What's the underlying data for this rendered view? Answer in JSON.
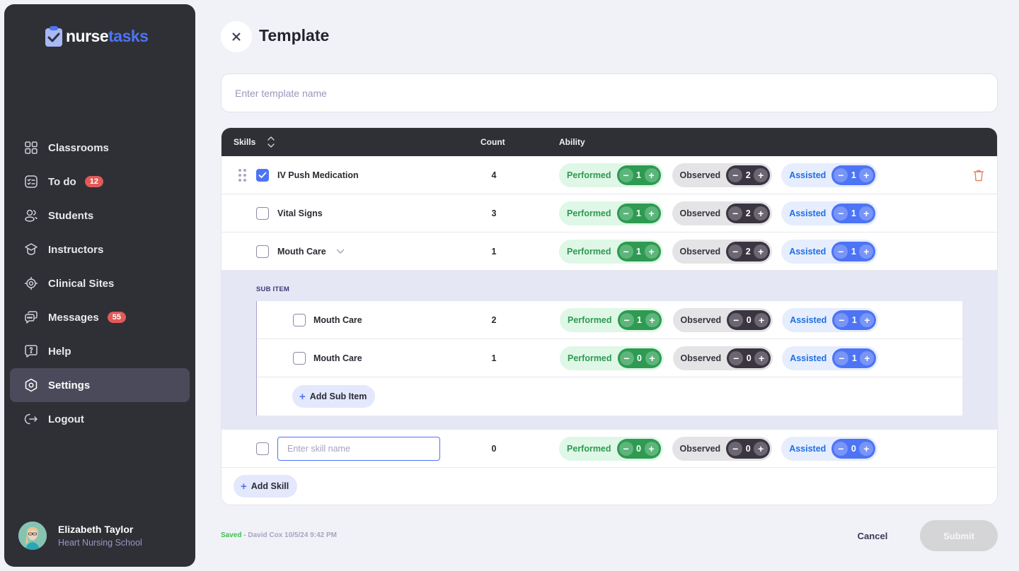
{
  "brand": {
    "name_part1": "nurse",
    "name_part2": "tasks",
    "accent": "#4d74f5"
  },
  "sidebar": {
    "items": [
      {
        "label": "Classrooms",
        "icon": "grid-icon",
        "badge": null
      },
      {
        "label": "To do",
        "icon": "checklist-icon",
        "badge": "12"
      },
      {
        "label": "Students",
        "icon": "users-icon",
        "badge": null
      },
      {
        "label": "Instructors",
        "icon": "graduation-cap-icon",
        "badge": null
      },
      {
        "label": "Clinical Sites",
        "icon": "target-icon",
        "badge": null
      },
      {
        "label": "Messages",
        "icon": "chat-icon",
        "badge": "55"
      },
      {
        "label": "Help",
        "icon": "help-icon",
        "badge": null
      },
      {
        "label": "Settings",
        "icon": "settings-icon",
        "badge": null,
        "active": true
      },
      {
        "label": "Logout",
        "icon": "logout-icon",
        "badge": null
      }
    ],
    "user": {
      "name": "Elizabeth Taylor",
      "school": "Heart Nursing School"
    }
  },
  "header": {
    "title": "Template",
    "close_icon": "close-icon"
  },
  "template_name": {
    "value": "",
    "placeholder": "Enter template name"
  },
  "table": {
    "columns": {
      "skills": "Skills",
      "count": "Count",
      "ability": "Ability"
    },
    "ability_labels": {
      "performed": "Performed",
      "observed": "Observed",
      "assisted": "Assisted"
    },
    "rows": [
      {
        "name": "IV Push Medication",
        "checked": true,
        "count": "4",
        "performed": "1",
        "observed": "2",
        "assisted": "1",
        "draggable": true,
        "deletable": true
      },
      {
        "name": "Vital Signs",
        "checked": false,
        "count": "3",
        "performed": "1",
        "observed": "2",
        "assisted": "1"
      },
      {
        "name": "Mouth Care",
        "checked": false,
        "count": "1",
        "performed": "1",
        "observed": "2",
        "assisted": "1",
        "expanded": true
      }
    ],
    "sub_section": {
      "label": "SUB ITEM",
      "items": [
        {
          "name": "Mouth Care",
          "checked": false,
          "count": "2",
          "performed": "1",
          "observed": "0",
          "assisted": "1"
        },
        {
          "name": "Mouth Care",
          "checked": false,
          "count": "1",
          "performed": "0",
          "observed": "0",
          "assisted": "1"
        }
      ],
      "add_label": "Add Sub Item"
    },
    "new_row": {
      "value": "",
      "placeholder": "Enter skill name",
      "checked": false,
      "count": "0",
      "performed": "0",
      "observed": "0",
      "assisted": "0"
    },
    "add_skill_label": "Add Skill"
  },
  "footer": {
    "saved_label": "Saved",
    "saved_meta": " - David Cox 10/5/24 9:42 PM",
    "cancel_label": "Cancel",
    "submit_label": "Submit"
  },
  "colors": {
    "performed": "#2e9a52",
    "observed": "#3a3541",
    "assisted": "#4d74f5",
    "badge": "#e25a58",
    "saved": "#3fbe4f"
  }
}
